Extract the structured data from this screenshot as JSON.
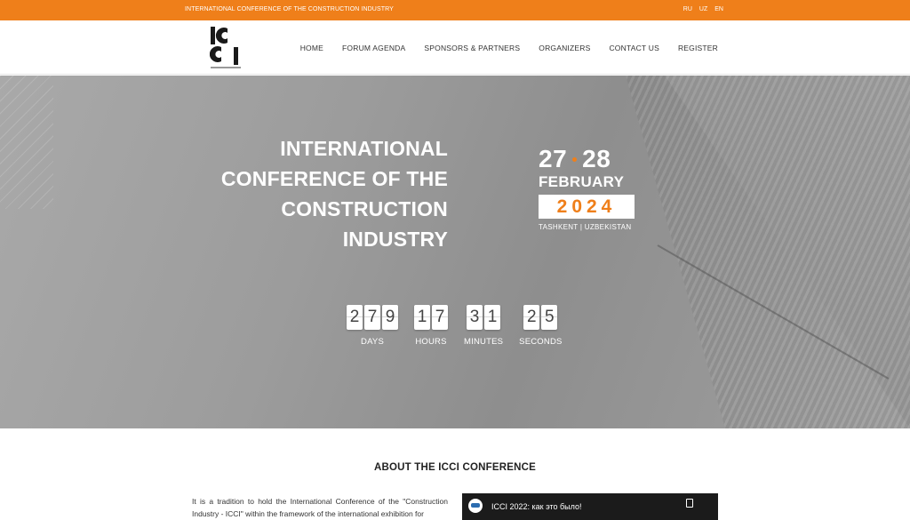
{
  "topbar": {
    "title": "INTERNATIONAL CONFERENCE OF THE CONSTRUCTION INDUSTRY",
    "languages": [
      "RU",
      "UZ",
      "EN"
    ]
  },
  "logo": {
    "text": "ICCI"
  },
  "nav": {
    "items": [
      "HOME",
      "FORUM AGENDA",
      "SPONSORS & PARTNERS",
      "ORGANIZERS",
      "CONTACT US",
      "REGISTER"
    ]
  },
  "hero": {
    "title_lines": [
      "INTERNATIONAL",
      "CONFERENCE OF THE",
      "CONSTRUCTION",
      "INDUSTRY"
    ],
    "date": {
      "day_start": "27",
      "day_end": "28",
      "month": "FEBRUARY",
      "year": "2024",
      "location": "TASHKENT | UZBEKISTAN"
    },
    "countdown": [
      {
        "digits": [
          "2",
          "7",
          "9"
        ],
        "label": "DAYS"
      },
      {
        "digits": [
          "1",
          "7"
        ],
        "label": "HOURS"
      },
      {
        "digits": [
          "3",
          "1"
        ],
        "label": "MINUTES"
      },
      {
        "digits": [
          "2",
          "5"
        ],
        "label": "SECONDS"
      }
    ]
  },
  "about": {
    "title": "ABOUT THE ICCI CONFERENCE",
    "text": "It is a tradition to hold the International Conference of the \"Construction Industry - ICCI\" within the framework of the international exhibition for",
    "video_title": "ICCI 2022: как это было!"
  },
  "colors": {
    "accent": "#ef7f1a"
  }
}
